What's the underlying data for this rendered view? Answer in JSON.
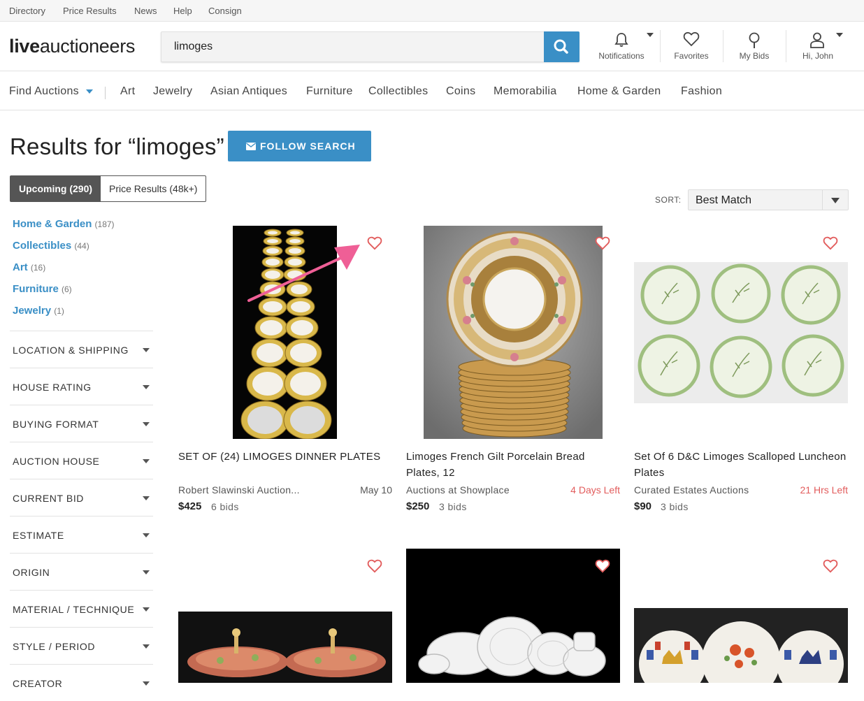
{
  "utility_nav": [
    "Directory",
    "Price Results",
    "News",
    "Help",
    "Consign"
  ],
  "logo": {
    "bold": "live",
    "light": "auctioneers"
  },
  "search": {
    "value": "limoges"
  },
  "header_icons": {
    "notifications": "Notifications",
    "favorites": "Favorites",
    "my_bids": "My Bids",
    "account": "Hi, John"
  },
  "main_nav": {
    "find": "Find Auctions",
    "items": [
      "Art",
      "Jewelry",
      "Asian Antiques",
      "Furniture",
      "Collectibles",
      "Coins",
      "Memorabilia",
      "Home & Garden",
      "Fashion"
    ]
  },
  "results_title": "Results for “limoges”",
  "follow_button": "FOLLOW SEARCH",
  "tabs": {
    "upcoming": "Upcoming (290)",
    "price": "Price Results (48k+)"
  },
  "sort": {
    "label": "SORT:",
    "value": "Best Match"
  },
  "categories": [
    {
      "name": "Home & Garden",
      "count": "(187)"
    },
    {
      "name": "Collectibles",
      "count": "(44)"
    },
    {
      "name": "Art",
      "count": "(16)"
    },
    {
      "name": "Furniture",
      "count": "(6)"
    },
    {
      "name": "Jewelry",
      "count": "(1)"
    }
  ],
  "facets": [
    "LOCATION & SHIPPING",
    "HOUSE RATING",
    "BUYING FORMAT",
    "AUCTION HOUSE",
    "CURRENT BID",
    "ESTIMATE",
    "ORIGIN",
    "MATERIAL / TECHNIQUE",
    "STYLE / PERIOD",
    "CREATOR"
  ],
  "items": [
    {
      "title": "SET OF (24) LIMOGES DINNER PLATES",
      "house": "Robert Slawinski Auction...",
      "time": "May 10",
      "price": "$425",
      "bids": "6 bids"
    },
    {
      "title": "Limoges French Gilt Porcelain Bread Plates, 12",
      "house": "Auctions at Showplace",
      "time": "4 Days Left",
      "price": "$250",
      "bids": "3 bids"
    },
    {
      "title": "Set Of 6 D&C Limoges Scalloped Luncheon Plates",
      "house": "Curated Estates Auctions",
      "time": "21 Hrs Left",
      "price": "$90",
      "bids": "3 bids"
    }
  ],
  "colors": {
    "brand": "#3a8fc6",
    "heart": "#e25c5c",
    "arrow": "#ef5f96"
  }
}
